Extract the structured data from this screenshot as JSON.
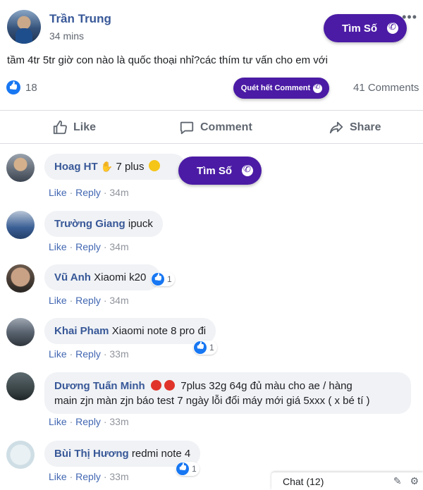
{
  "post": {
    "author": "Trần Trung",
    "time": "34 mins",
    "cta_label": "Tìm Số",
    "text": "tầm 4tr 5tr giờ con nào là quốc thoại nhỉ?các thím tư vấn cho em với",
    "reactions_count": "18",
    "quet_label": "Quét hết Comment",
    "comments_count": "41 Comments"
  },
  "actions": {
    "like": "Like",
    "comment": "Comment",
    "share": "Share"
  },
  "comments": [
    {
      "name": "Hoag HT",
      "text": "7 plus",
      "like": "Like",
      "reply": "Reply",
      "time": "34m",
      "cta_label": "Tìm Số"
    },
    {
      "name": "Trường Giang",
      "text": "ipuck",
      "like": "Like",
      "reply": "Reply",
      "time": "34m"
    },
    {
      "name": "Vũ Anh",
      "text": "Xiaomi k20",
      "like": "Like",
      "reply": "Reply",
      "time": "34m",
      "likes": "1"
    },
    {
      "name": "Khai Pham",
      "text": "Xiaomi note 8 pro đi",
      "like": "Like",
      "reply": "Reply",
      "time": "33m",
      "likes": "1"
    },
    {
      "name": "Dương Tuấn Minh",
      "text": "7plus 32g 64g đủ màu cho ae / hàng",
      "text2": "main zjn màn zjn báo test 7 ngày lỗi đổi máy mới giá 5xxx ( x bé tí )",
      "like": "Like",
      "reply": "Reply",
      "time": "33m"
    },
    {
      "name": "Bùi Thị Hương",
      "text": "redmi note 4",
      "like": "Like",
      "reply": "Reply",
      "time": "33m",
      "likes": "1"
    }
  ],
  "meta_separator": "·",
  "chat": {
    "label": "Chat (12)"
  },
  "colors": {
    "brand_purple": "#4b1ba5",
    "fb_blue": "#1877f2",
    "name_blue": "#385898"
  },
  "icons": [
    "more-icon",
    "phone-icon",
    "like-icon",
    "comment-icon",
    "share-icon",
    "compose-icon",
    "settings-icon"
  ]
}
